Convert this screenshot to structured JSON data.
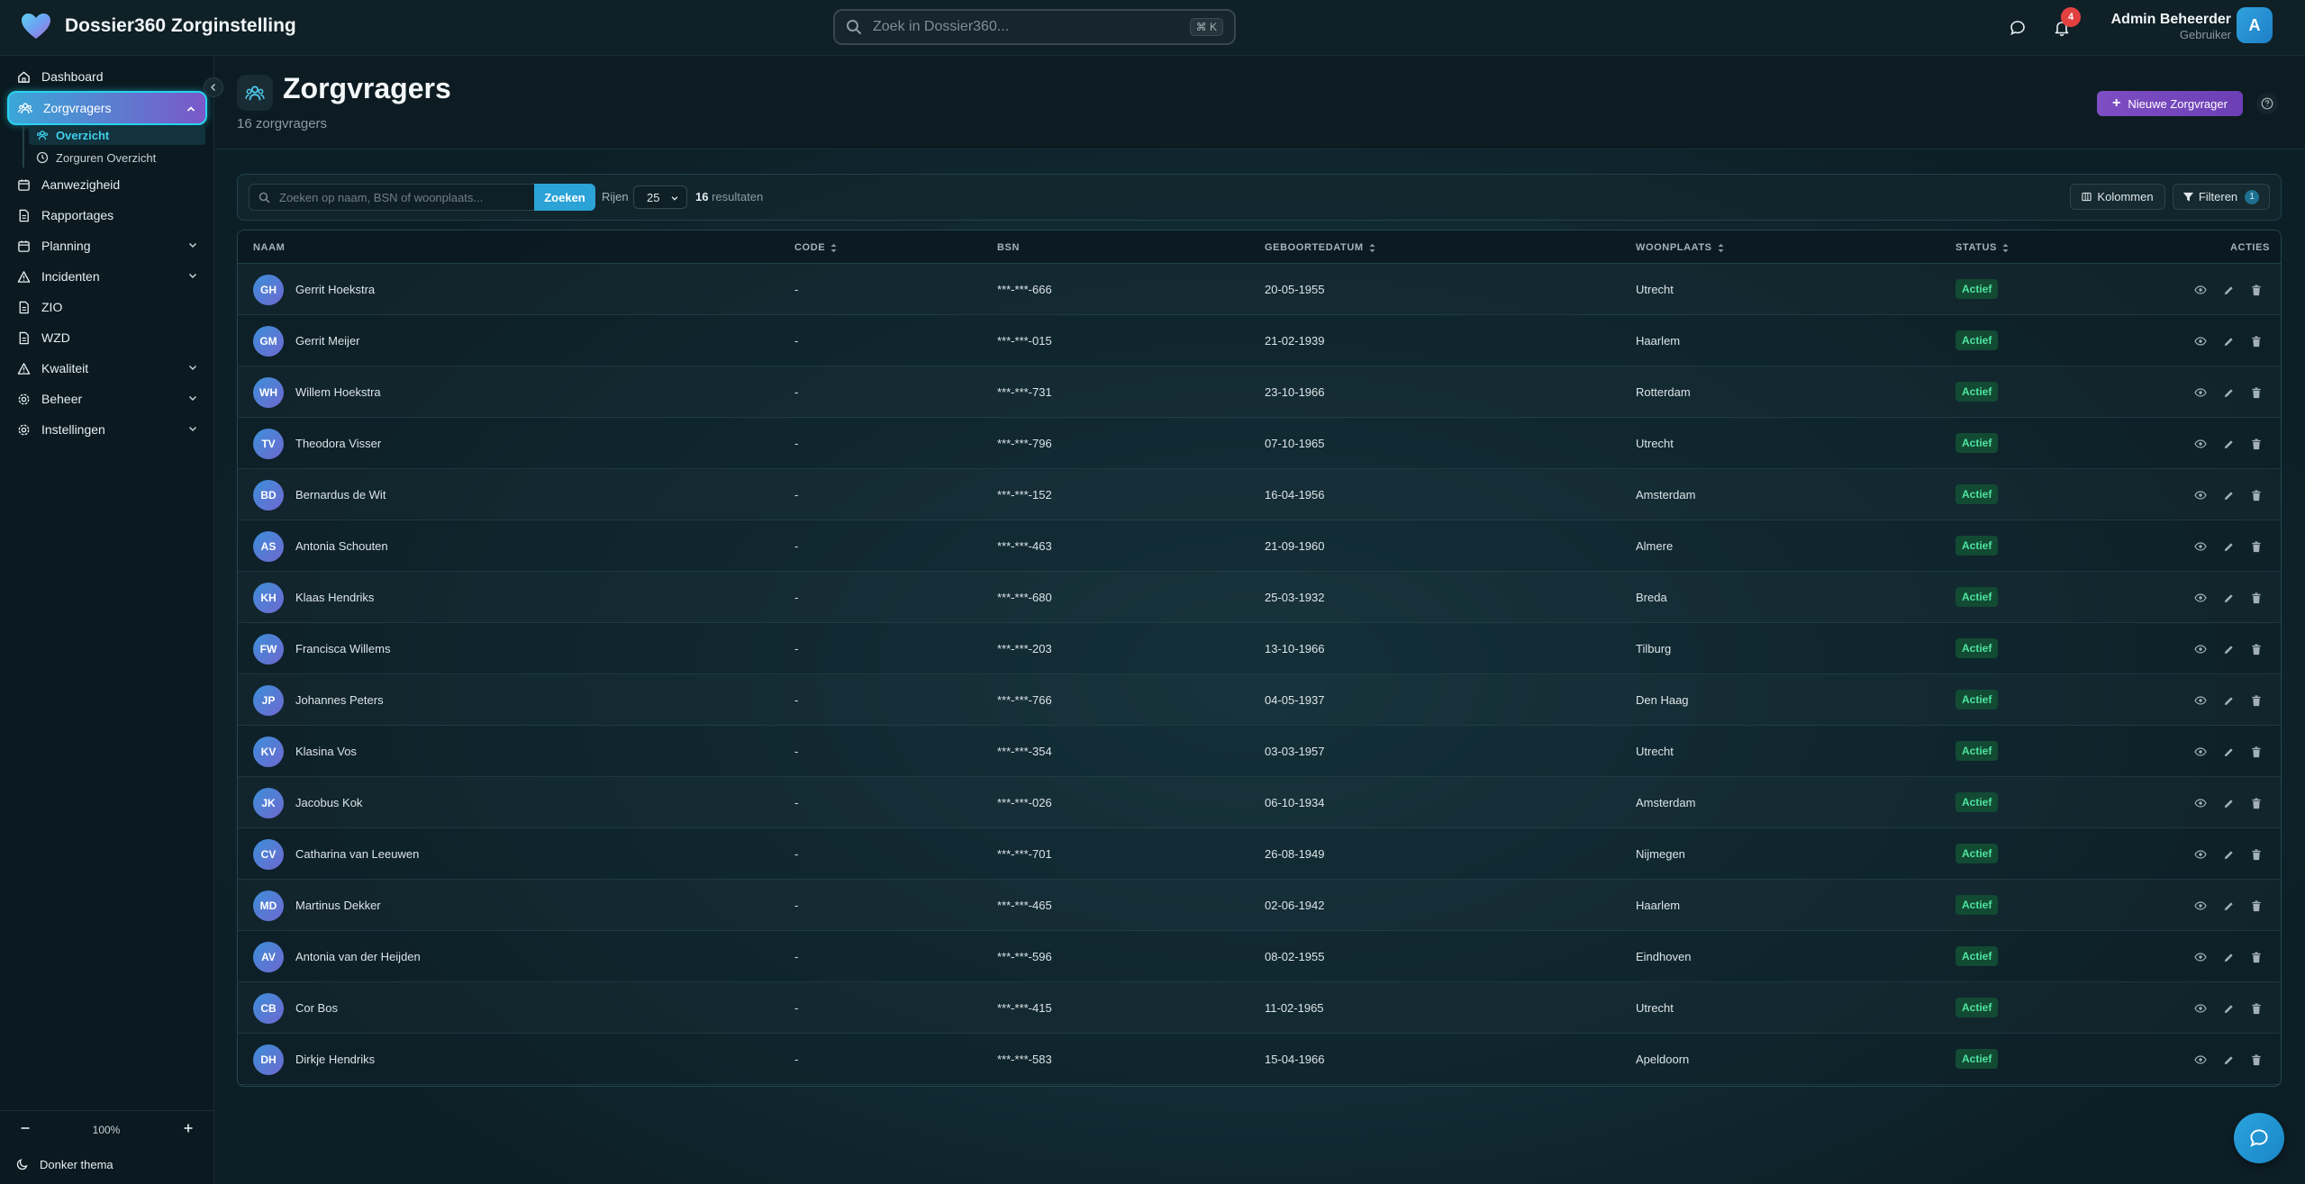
{
  "app": {
    "title": "Dossier360 Zorginstelling",
    "search_placeholder": "Zoek in Dossier360...",
    "search_shortcut": "⌘ K",
    "notification_count": "4",
    "user_name": "Admin Beheerder",
    "user_role": "Gebruiker",
    "user_initial": "A"
  },
  "sidebar": {
    "items": [
      {
        "label": "Dashboard",
        "icon": "home-icon"
      },
      {
        "label": "Zorgvragers",
        "icon": "users-icon",
        "active": true,
        "expanded": true
      },
      {
        "label": "Aanwezigheid",
        "icon": "calendar-icon"
      },
      {
        "label": "Rapportages",
        "icon": "document-icon"
      },
      {
        "label": "Planning",
        "icon": "calendar-icon",
        "has_children": true
      },
      {
        "label": "Incidenten",
        "icon": "warning-icon",
        "has_children": true
      },
      {
        "label": "ZIO",
        "icon": "document-icon"
      },
      {
        "label": "WZD",
        "icon": "document-icon"
      },
      {
        "label": "Kwaliteit",
        "icon": "warning-icon",
        "has_children": true
      },
      {
        "label": "Beheer",
        "icon": "gear-icon",
        "has_children": true
      },
      {
        "label": "Instellingen",
        "icon": "gear-icon",
        "has_children": true
      }
    ],
    "sub_items": [
      {
        "label": "Overzicht",
        "icon": "users-icon",
        "active": true
      },
      {
        "label": "Zorguren Overzicht",
        "icon": "clock-icon"
      }
    ],
    "zoom": "100%",
    "theme_label": "Donker thema"
  },
  "page": {
    "title": "Zorgvragers",
    "subtitle": "16 zorgvragers",
    "new_button": "Nieuwe Zorgvrager"
  },
  "filters": {
    "search_placeholder": "Zoeken op naam, BSN of woonplaats...",
    "search_button": "Zoeken",
    "rows_label": "Rijen",
    "rows_value": "25",
    "result_count": "16",
    "result_label": "resultaten",
    "columns_button": "Kolommen",
    "filter_button": "Filteren",
    "filter_count": "1"
  },
  "table": {
    "headers": {
      "name": "NAAM",
      "code": "CODE",
      "bsn": "BSN",
      "dob": "GEBOORTEDATUM",
      "city": "WOONPLAATS",
      "status": "STATUS",
      "actions": "ACTIES"
    },
    "rows": [
      {
        "initials": "GH",
        "name": "Gerrit Hoekstra",
        "code": "-",
        "bsn": "***-***-666",
        "dob": "20-05-1955",
        "city": "Utrecht",
        "status": "Actief"
      },
      {
        "initials": "GM",
        "name": "Gerrit Meijer",
        "code": "-",
        "bsn": "***-***-015",
        "dob": "21-02-1939",
        "city": "Haarlem",
        "status": "Actief"
      },
      {
        "initials": "WH",
        "name": "Willem Hoekstra",
        "code": "-",
        "bsn": "***-***-731",
        "dob": "23-10-1966",
        "city": "Rotterdam",
        "status": "Actief"
      },
      {
        "initials": "TV",
        "name": "Theodora Visser",
        "code": "-",
        "bsn": "***-***-796",
        "dob": "07-10-1965",
        "city": "Utrecht",
        "status": "Actief"
      },
      {
        "initials": "BD",
        "name": "Bernardus de Wit",
        "code": "-",
        "bsn": "***-***-152",
        "dob": "16-04-1956",
        "city": "Amsterdam",
        "status": "Actief"
      },
      {
        "initials": "AS",
        "name": "Antonia Schouten",
        "code": "-",
        "bsn": "***-***-463",
        "dob": "21-09-1960",
        "city": "Almere",
        "status": "Actief"
      },
      {
        "initials": "KH",
        "name": "Klaas Hendriks",
        "code": "-",
        "bsn": "***-***-680",
        "dob": "25-03-1932",
        "city": "Breda",
        "status": "Actief"
      },
      {
        "initials": "FW",
        "name": "Francisca Willems",
        "code": "-",
        "bsn": "***-***-203",
        "dob": "13-10-1966",
        "city": "Tilburg",
        "status": "Actief"
      },
      {
        "initials": "JP",
        "name": "Johannes Peters",
        "code": "-",
        "bsn": "***-***-766",
        "dob": "04-05-1937",
        "city": "Den Haag",
        "status": "Actief"
      },
      {
        "initials": "KV",
        "name": "Klasina Vos",
        "code": "-",
        "bsn": "***-***-354",
        "dob": "03-03-1957",
        "city": "Utrecht",
        "status": "Actief"
      },
      {
        "initials": "JK",
        "name": "Jacobus Kok",
        "code": "-",
        "bsn": "***-***-026",
        "dob": "06-10-1934",
        "city": "Amsterdam",
        "status": "Actief"
      },
      {
        "initials": "CV",
        "name": "Catharina van Leeuwen",
        "code": "-",
        "bsn": "***-***-701",
        "dob": "26-08-1949",
        "city": "Nijmegen",
        "status": "Actief"
      },
      {
        "initials": "MD",
        "name": "Martinus Dekker",
        "code": "-",
        "bsn": "***-***-465",
        "dob": "02-06-1942",
        "city": "Haarlem",
        "status": "Actief"
      },
      {
        "initials": "AV",
        "name": "Antonia van der Heijden",
        "code": "-",
        "bsn": "***-***-596",
        "dob": "08-02-1955",
        "city": "Eindhoven",
        "status": "Actief"
      },
      {
        "initials": "CB",
        "name": "Cor Bos",
        "code": "-",
        "bsn": "***-***-415",
        "dob": "11-02-1965",
        "city": "Utrecht",
        "status": "Actief"
      },
      {
        "initials": "DH",
        "name": "Dirkje Hendriks",
        "code": "-",
        "bsn": "***-***-583",
        "dob": "15-04-1966",
        "city": "Apeldoorn",
        "status": "Actief"
      }
    ]
  },
  "colors": {
    "accent": "#2ba3d7",
    "brand_purple": "#7e4ec3",
    "status_active": "#4fe3a0",
    "background": "#0d1c22"
  }
}
